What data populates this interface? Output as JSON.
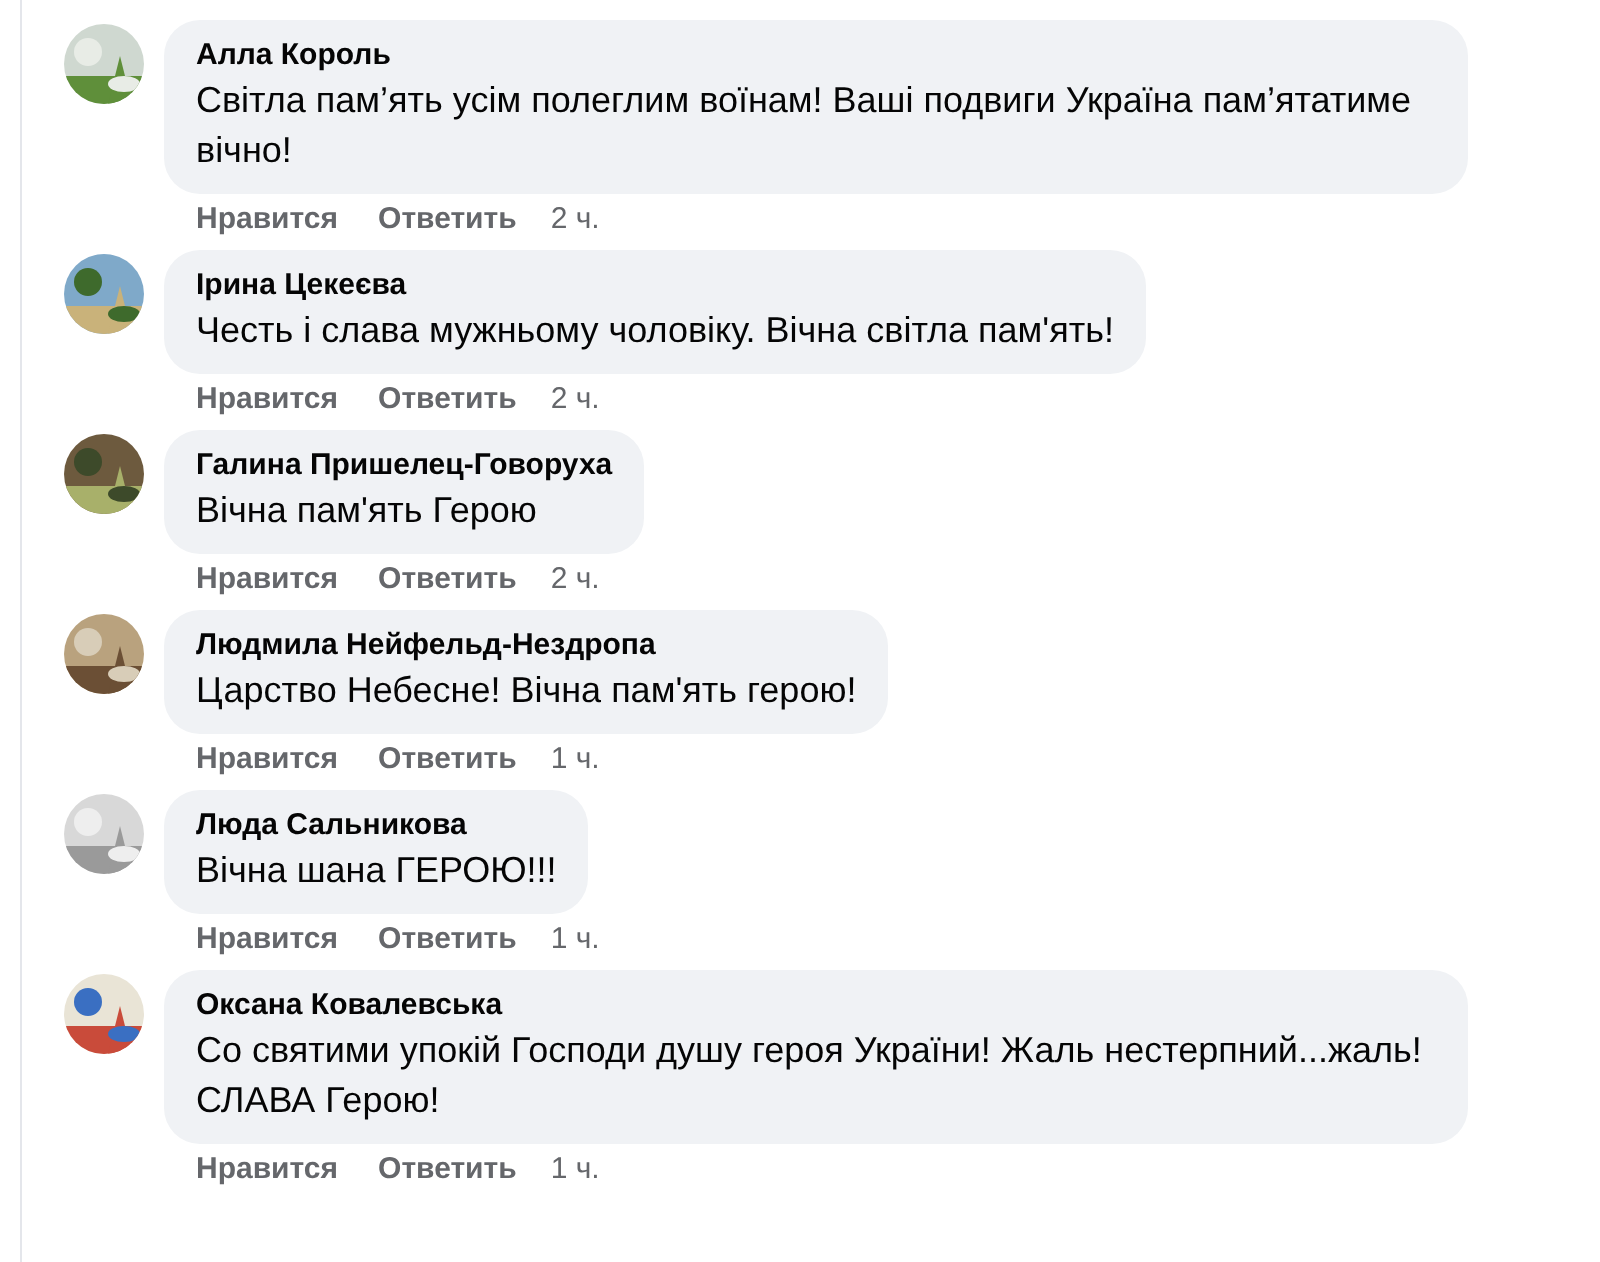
{
  "comments": [
    {
      "author": "Алла Король",
      "text": "Світла пам’ять усім полеглим воїнам! Ваші подвиги Україна пам’ятатиме вічно!",
      "like": "Нравится",
      "reply": "Ответить",
      "time": "2 ч."
    },
    {
      "author": "Ірина Цекеєва",
      "text": "Честь і слава мужньому чоловіку. Вічна світла пам'ять!",
      "like": "Нравится",
      "reply": "Ответить",
      "time": "2 ч."
    },
    {
      "author": "Галина Пришелец-Говоруха",
      "text": "Вічна пам'ять Герою",
      "like": "Нравится",
      "reply": "Ответить",
      "time": "2 ч."
    },
    {
      "author": "Людмила Нейфельд-Нездропа",
      "text": "Царство Небесне! Вічна пам'ять герою!",
      "like": "Нравится",
      "reply": "Ответить",
      "time": "1 ч."
    },
    {
      "author": "Люда Сальникова",
      "text": "Вічна шана ГЕРОЮ!!!",
      "like": "Нравится",
      "reply": "Ответить",
      "time": "1 ч."
    },
    {
      "author": "Оксана Ковалевська",
      "text": "Со святими упокій Господи душу героя України! Жаль нестерпний...жаль! СЛАВА Герою!",
      "like": "Нравится",
      "reply": "Ответить",
      "time": "1 ч."
    }
  ]
}
